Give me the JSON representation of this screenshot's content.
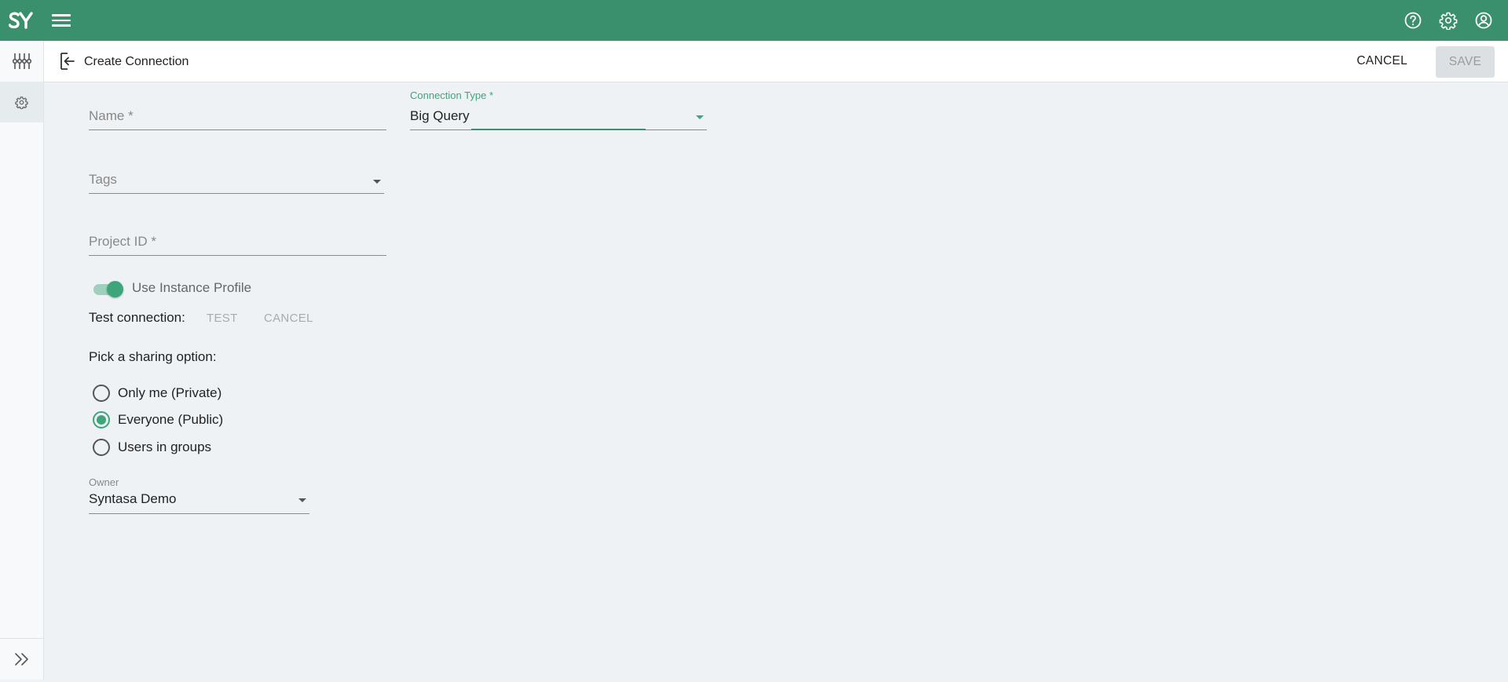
{
  "header": {
    "logo_text": "SY",
    "menu_icon": "hamburger-menu-icon",
    "icons": [
      "help-icon",
      "gear-icon",
      "account-icon"
    ],
    "brand_color": "#3a8f6d"
  },
  "sidebar": {
    "items": [
      "sliders-icon",
      "gear-icon"
    ],
    "expand_icon": "double-chevron-right-icon"
  },
  "toolbar": {
    "title": "Create Connection",
    "cancel_label": "CANCEL",
    "save_label": "SAVE"
  },
  "form": {
    "name": {
      "placeholder": "Name *",
      "value": ""
    },
    "connection_type": {
      "label": "Connection Type *",
      "value": "Big Query"
    },
    "tags": {
      "placeholder": "Tags"
    },
    "project_id": {
      "placeholder": "Project ID *",
      "value": ""
    },
    "instance_profile": {
      "label": "Use Instance Profile",
      "on": true
    },
    "test_connection": {
      "label": "Test connection:",
      "test_label": "TEST",
      "cancel_label": "CANCEL"
    },
    "sharing": {
      "label": "Pick a sharing option:",
      "options": [
        "Only me (Private)",
        "Everyone (Public)",
        "Users in groups"
      ],
      "selected": "Everyone (Public)"
    },
    "owner": {
      "label": "Owner",
      "value": "Syntasa Demo"
    }
  },
  "colors": {
    "accent": "#3ea57a"
  }
}
